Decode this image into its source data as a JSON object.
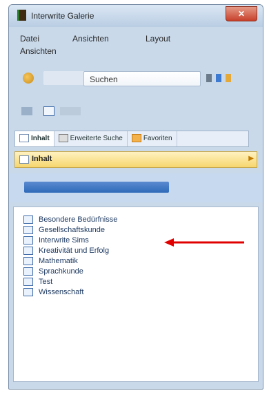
{
  "window": {
    "title": "Interwrite Galerie",
    "close_label": "✕"
  },
  "menu": {
    "items": [
      "Datei",
      "Ansichten",
      "Layout",
      "Ansichten"
    ]
  },
  "search": {
    "button_label": "Suchen"
  },
  "tabs": [
    {
      "label": "Inhalt",
      "active": true
    },
    {
      "label": "Erweiterte Suche",
      "active": false
    },
    {
      "label": "Favoriten",
      "active": false
    }
  ],
  "section": {
    "label": "Inhalt"
  },
  "tree": {
    "items": [
      "Besondere Bedürfnisse",
      "Gesellschaftskunde",
      "Interwrite Sims",
      "Kreativität und Erfolg",
      "Mathematik",
      "Sprachkunde",
      "Test",
      "Wissenschaft"
    ]
  },
  "colors": {
    "annotation_arrow": "#e00000",
    "accent": "#2f6bb9"
  }
}
